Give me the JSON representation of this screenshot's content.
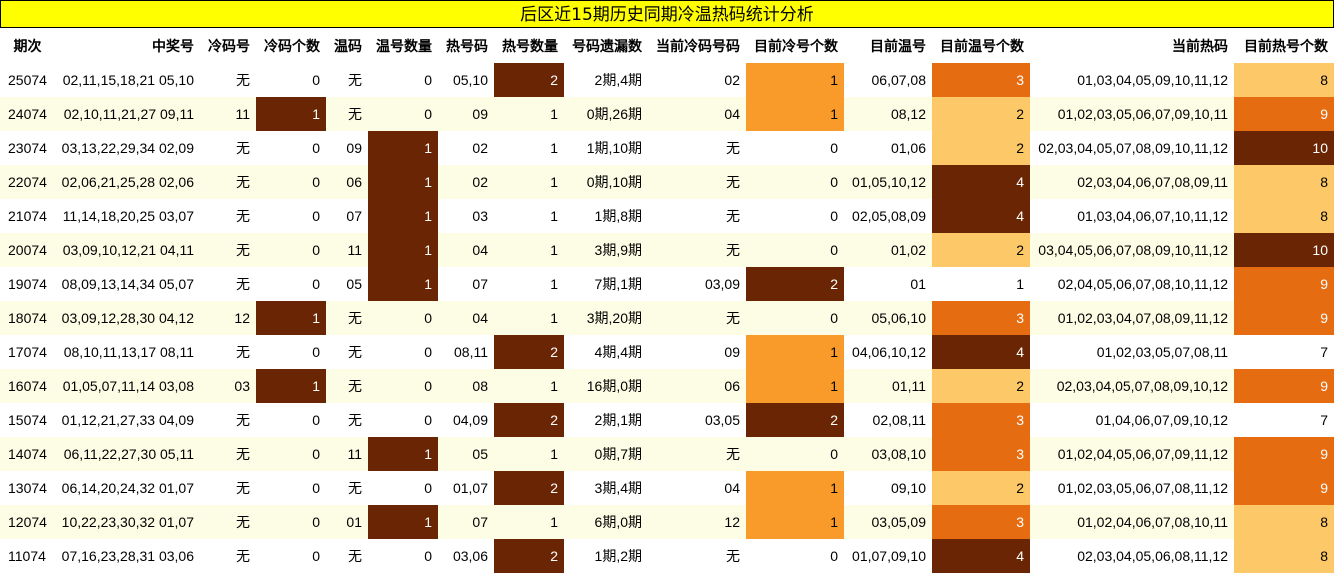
{
  "title": "后区近15期历史同期冷温热码统计分析",
  "headers": [
    "期次",
    "中奖号",
    "冷码号",
    "冷码个数",
    "温码",
    "温号数量",
    "热号码",
    "热号数量",
    "号码遗漏数",
    "当前冷码号码",
    "目前冷号个数",
    "目前温号",
    "目前温号个数",
    "当前热码",
    "目前热号个数"
  ],
  "rows": [
    [
      "25074",
      "02,11,15,18,21 05,10",
      "无",
      "0",
      "无",
      "0",
      "05,10",
      "2",
      "2期,4期",
      "02",
      "1",
      "06,07,08",
      "3",
      "01,03,04,05,09,10,11,12",
      "8"
    ],
    [
      "24074",
      "02,10,11,21,27 09,11",
      "11",
      "1",
      "无",
      "0",
      "09",
      "1",
      "0期,26期",
      "04",
      "1",
      "08,12",
      "2",
      "01,02,03,05,06,07,09,10,11",
      "9"
    ],
    [
      "23074",
      "03,13,22,29,34 02,09",
      "无",
      "0",
      "09",
      "1",
      "02",
      "1",
      "1期,10期",
      "无",
      "0",
      "01,06",
      "2",
      "02,03,04,05,07,08,09,10,11,12",
      "10"
    ],
    [
      "22074",
      "02,06,21,25,28 02,06",
      "无",
      "0",
      "06",
      "1",
      "02",
      "1",
      "0期,10期",
      "无",
      "0",
      "01,05,10,12",
      "4",
      "02,03,04,06,07,08,09,11",
      "8"
    ],
    [
      "21074",
      "11,14,18,20,25 03,07",
      "无",
      "0",
      "07",
      "1",
      "03",
      "1",
      "1期,8期",
      "无",
      "0",
      "02,05,08,09",
      "4",
      "01,03,04,06,07,10,11,12",
      "8"
    ],
    [
      "20074",
      "03,09,10,12,21 04,11",
      "无",
      "0",
      "11",
      "1",
      "04",
      "1",
      "3期,9期",
      "无",
      "0",
      "01,02",
      "2",
      "03,04,05,06,07,08,09,10,11,12",
      "10"
    ],
    [
      "19074",
      "08,09,13,14,34 05,07",
      "无",
      "0",
      "05",
      "1",
      "07",
      "1",
      "7期,1期",
      "03,09",
      "2",
      "01",
      "1",
      "02,04,05,06,07,08,10,11,12",
      "9"
    ],
    [
      "18074",
      "03,09,12,28,30 04,12",
      "12",
      "1",
      "无",
      "0",
      "04",
      "1",
      "3期,20期",
      "无",
      "0",
      "05,06,10",
      "3",
      "01,02,03,04,07,08,09,11,12",
      "9"
    ],
    [
      "17074",
      "08,10,11,13,17 08,11",
      "无",
      "0",
      "无",
      "0",
      "08,11",
      "2",
      "4期,4期",
      "09",
      "1",
      "04,06,10,12",
      "4",
      "01,02,03,05,07,08,11",
      "7"
    ],
    [
      "16074",
      "01,05,07,11,14 03,08",
      "03",
      "1",
      "无",
      "0",
      "08",
      "1",
      "16期,0期",
      "06",
      "1",
      "01,11",
      "2",
      "02,03,04,05,07,08,09,10,12",
      "9"
    ],
    [
      "15074",
      "01,12,21,27,33 04,09",
      "无",
      "0",
      "无",
      "0",
      "04,09",
      "2",
      "2期,1期",
      "03,05",
      "2",
      "02,08,11",
      "3",
      "01,04,06,07,09,10,12",
      "7"
    ],
    [
      "14074",
      "06,11,22,27,30 05,11",
      "无",
      "0",
      "11",
      "1",
      "05",
      "1",
      "0期,7期",
      "无",
      "0",
      "03,08,10",
      "3",
      "01,02,04,05,06,07,09,11,12",
      "9"
    ],
    [
      "13074",
      "06,14,20,24,32 01,07",
      "无",
      "0",
      "无",
      "0",
      "01,07",
      "2",
      "3期,4期",
      "04",
      "1",
      "09,10",
      "2",
      "01,02,03,05,06,07,08,11,12",
      "9"
    ],
    [
      "12074",
      "10,22,23,30,32 01,07",
      "无",
      "0",
      "01",
      "1",
      "07",
      "1",
      "6期,0期",
      "12",
      "1",
      "03,05,09",
      "3",
      "01,02,04,06,07,08,10,11",
      "8"
    ],
    [
      "11074",
      "07,16,23,28,31 03,06",
      "无",
      "0",
      "无",
      "0",
      "03,06",
      "2",
      "1期,2期",
      "无",
      "0",
      "01,07,09,10",
      "4",
      "02,03,04,05,06,08,11,12",
      "8"
    ]
  ],
  "colors": {
    "title_bg": "#ffff00",
    "dark_brown": "#6a2604",
    "orange": "#f99b2b",
    "deep_orange": "#e66c12",
    "light_orange": "#fdc867",
    "cream": "#fdfce5"
  }
}
